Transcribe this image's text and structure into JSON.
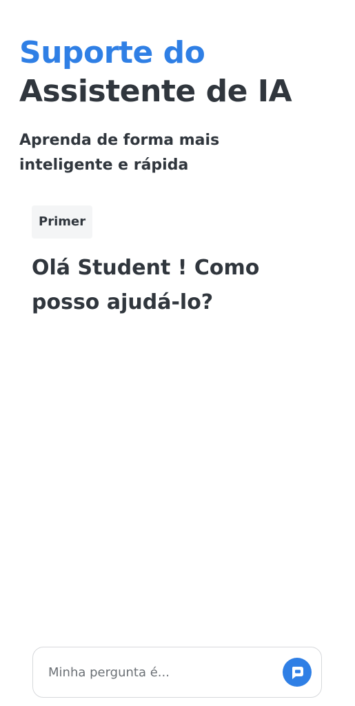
{
  "header": {
    "title_line1": "Suporte do",
    "title_line2": "Assistente de IA",
    "subtitle": "Aprenda de forma mais inteligente e rápida"
  },
  "chat": {
    "chip_label": "Primer",
    "greeting": "Olá Student ! Como posso ajudá-lo?"
  },
  "input": {
    "placeholder": "Minha pergunta é...",
    "value": ""
  },
  "send_button": {
    "icon": "chat-bubble-icon"
  },
  "colors": {
    "accent": "#2f7fe5",
    "text": "#30363d"
  }
}
